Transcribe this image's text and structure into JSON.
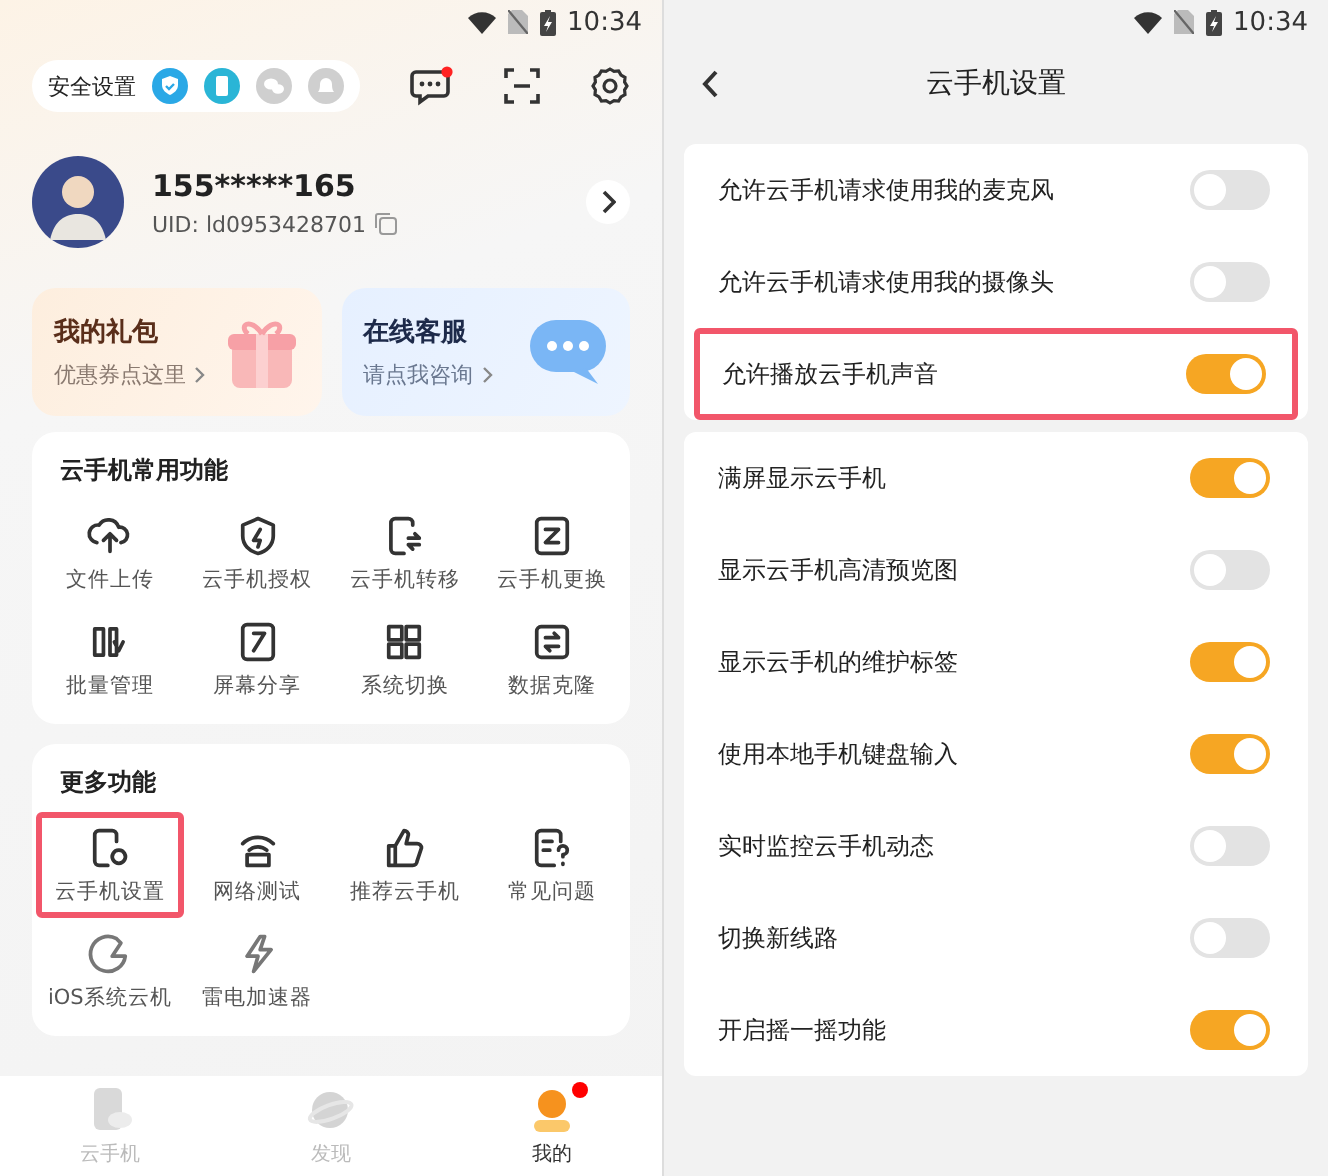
{
  "left": {
    "status_time": "10:34",
    "security_label": "安全设置",
    "profile": {
      "phone": "155*****165",
      "uid": "UID: ld0953428701"
    },
    "promos": [
      {
        "kind": "gift",
        "title": "我的礼包",
        "subtitle": "优惠券点这里"
      },
      {
        "kind": "service",
        "title": "在线客服",
        "subtitle": "请点我咨询"
      }
    ],
    "sections": [
      {
        "title": "云手机常用功能",
        "items": [
          {
            "label": "文件上传",
            "highlighted": false
          },
          {
            "label": "云手机授权",
            "highlighted": false
          },
          {
            "label": "云手机转移",
            "highlighted": false
          },
          {
            "label": "云手机更换",
            "highlighted": false
          },
          {
            "label": "批量管理",
            "highlighted": false
          },
          {
            "label": "屏幕分享",
            "highlighted": false
          },
          {
            "label": "系统切换",
            "highlighted": false
          },
          {
            "label": "数据克隆",
            "highlighted": false
          }
        ]
      },
      {
        "title": "更多功能",
        "items": [
          {
            "label": "云手机设置",
            "highlighted": true
          },
          {
            "label": "网络测试",
            "highlighted": false
          },
          {
            "label": "推荐云手机",
            "highlighted": false
          },
          {
            "label": "常见问题",
            "highlighted": false
          },
          {
            "label": "iOS系统云机",
            "highlighted": false
          },
          {
            "label": "雷电加速器",
            "highlighted": false
          }
        ]
      }
    ],
    "tabs": [
      {
        "label": "云手机",
        "selected": false,
        "badge": false
      },
      {
        "label": "发现",
        "selected": false,
        "badge": false
      },
      {
        "label": "我的",
        "selected": true,
        "badge": true
      }
    ]
  },
  "right": {
    "status_time": "10:34",
    "title": "云手机设置",
    "groups": [
      [
        {
          "label": "允许云手机请求使用我的麦克风",
          "on": false,
          "highlighted": false
        },
        {
          "label": "允许云手机请求使用我的摄像头",
          "on": false,
          "highlighted": false
        },
        {
          "label": "允许播放云手机声音",
          "on": true,
          "highlighted": true
        }
      ],
      [
        {
          "label": "满屏显示云手机",
          "on": true,
          "highlighted": false
        },
        {
          "label": "显示云手机高清预览图",
          "on": false,
          "highlighted": false
        },
        {
          "label": "显示云手机的维护标签",
          "on": true,
          "highlighted": false
        },
        {
          "label": "使用本地手机键盘输入",
          "on": true,
          "highlighted": false
        },
        {
          "label": "实时监控云手机动态",
          "on": false,
          "highlighted": false
        },
        {
          "label": "切换新线路",
          "on": false,
          "highlighted": false
        },
        {
          "label": "开启摇一摇功能",
          "on": true,
          "highlighted": false
        }
      ]
    ]
  }
}
